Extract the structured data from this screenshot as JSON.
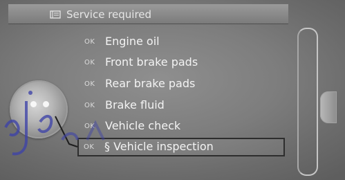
{
  "header": {
    "title": "Service required",
    "icon": "service-book-icon"
  },
  "service_items": [
    {
      "status": "OK",
      "label": "Engine oil"
    },
    {
      "status": "OK",
      "label": "Front brake pads"
    },
    {
      "status": "OK",
      "label": "Rear brake pads"
    },
    {
      "status": "OK",
      "label": "Brake fluid"
    },
    {
      "status": "OK",
      "label": "Vehicle check"
    },
    {
      "status": "OK",
      "label": "§ Vehicle inspection"
    }
  ],
  "selected_index": 5,
  "colors": {
    "text": "#f3f3f3",
    "background": "#7d7d7d",
    "watermark": "#3d43a8"
  }
}
